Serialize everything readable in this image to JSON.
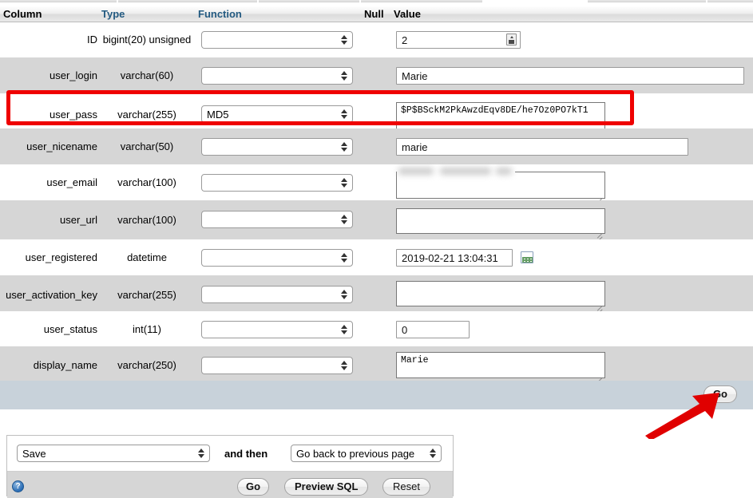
{
  "table": {
    "headers": {
      "column": "Column",
      "type": "Type",
      "function": "Function",
      "null": "Null",
      "value": "Value"
    },
    "rows": [
      {
        "column": "ID",
        "type": "bigint(20) unsigned",
        "function": "",
        "value": "2"
      },
      {
        "column": "user_login",
        "type": "varchar(60)",
        "function": "",
        "value": "Marie"
      },
      {
        "column": "user_pass",
        "type": "varchar(255)",
        "function": "MD5",
        "value": "$P$BSckM2PkAwzdEqv8DE/he7Oz0PO7kT1"
      },
      {
        "column": "user_nicename",
        "type": "varchar(50)",
        "function": "",
        "value": "marie"
      },
      {
        "column": "user_email",
        "type": "varchar(100)",
        "function": "",
        "value": ""
      },
      {
        "column": "user_url",
        "type": "varchar(100)",
        "function": "",
        "value": ""
      },
      {
        "column": "user_registered",
        "type": "datetime",
        "function": "",
        "value": "2019-02-21 13:04:31"
      },
      {
        "column": "user_activation_key",
        "type": "varchar(255)",
        "function": "",
        "value": ""
      },
      {
        "column": "user_status",
        "type": "int(11)",
        "function": "",
        "value": "0"
      },
      {
        "column": "display_name",
        "type": "varchar(250)",
        "function": "",
        "value": "Marie"
      }
    ]
  },
  "go_bar": {
    "go_label": "Go"
  },
  "action_panel": {
    "save_select": "Save",
    "and_then_label": "and then",
    "then_select": "Go back to previous page",
    "go_label": "Go",
    "preview_sql_label": "Preview SQL",
    "reset_label": "Reset",
    "help_glyph": "?"
  },
  "annotations": {
    "highlight_color": "#ef0000",
    "arrow_color": "#e00000",
    "header_link_color": "#235a81"
  }
}
